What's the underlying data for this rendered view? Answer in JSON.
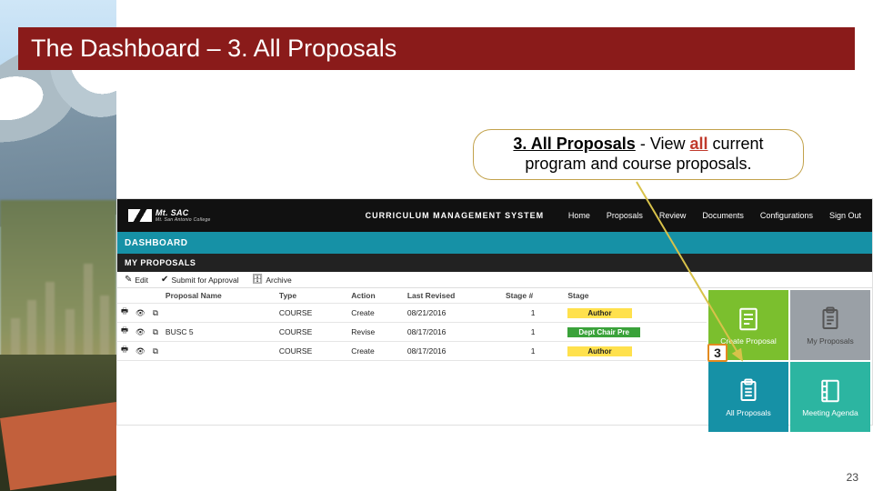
{
  "slide_title": "The Dashboard – 3. All Proposals",
  "callout": {
    "prefix_bold": "3. All Proposals",
    "dash": " - ",
    "mid": "View ",
    "all_red": "all",
    "rest": " current",
    "line2": "program and course proposals."
  },
  "app": {
    "logo_text": "Mt. SAC",
    "logo_sub": "Mt. San Antonio College",
    "system_name": "CURRICULUM MANAGEMENT SYSTEM",
    "nav": [
      "Home",
      "Proposals",
      "Review",
      "Documents",
      "Configurations",
      "Sign Out"
    ],
    "dashboard_label": "DASHBOARD",
    "my_proposals_label": "MY PROPOSALS",
    "toolbar": {
      "edit": "Edit",
      "submit": "Submit for Approval",
      "archive": "Archive"
    },
    "columns": [
      "",
      "",
      "",
      "Proposal Name",
      "Type",
      "Action",
      "Last Revised",
      "Stage #",
      "Stage"
    ],
    "rows": [
      {
        "name": "",
        "type": "COURSE",
        "action": "Create",
        "date": "08/21/2016",
        "stage_num": "1",
        "stage_label": "Author",
        "stage_class": "stage0"
      },
      {
        "name": "BUSC 5",
        "type": "COURSE",
        "action": "Revise",
        "date": "08/17/2016",
        "stage_num": "1",
        "stage_label": "Dept Chair Pre",
        "stage_class": "stage1"
      },
      {
        "name": "",
        "type": "COURSE",
        "action": "Create",
        "date": "08/17/2016",
        "stage_num": "1",
        "stage_label": "Author",
        "stage_class": "stage0"
      }
    ],
    "tiles": {
      "create": "Create Proposal",
      "my": "My Proposals",
      "all": "All Proposals",
      "agenda": "Meeting Agenda"
    }
  },
  "badge3": "3",
  "page_number": "23"
}
